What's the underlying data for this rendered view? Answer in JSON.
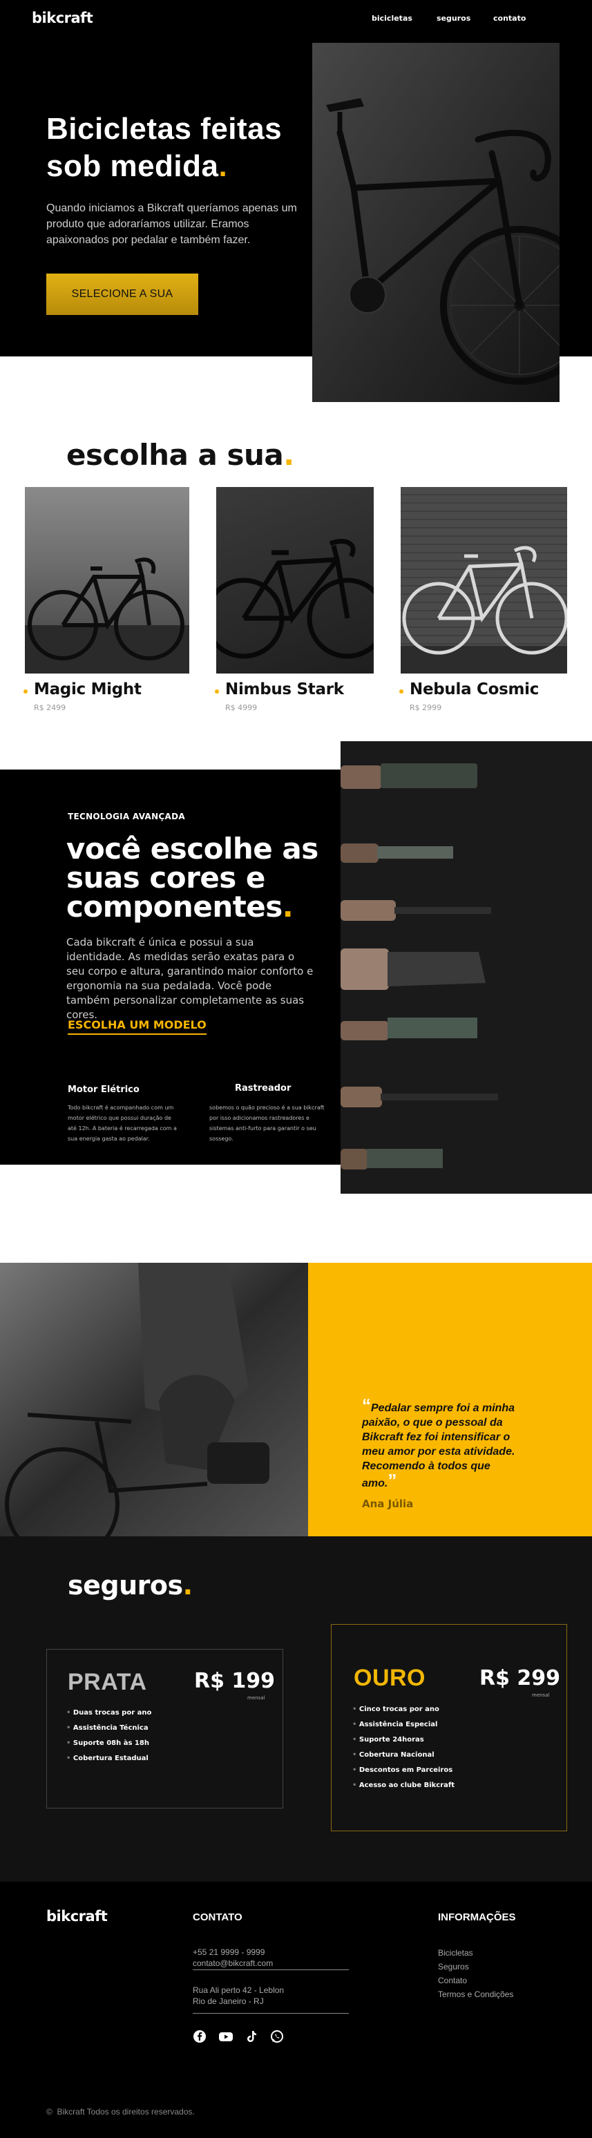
{
  "header": {
    "logo": "bikcraft",
    "nav": [
      "bicicletas",
      "seguros",
      "contato"
    ]
  },
  "hero": {
    "title_line1": "Bicicletas feitas",
    "title_line2": "sob  medida",
    "title_dot": ".",
    "subtitle": "Quando iniciamos a Bikcraft queríamos apenas um produto que adoraríamos utilizar. Eramos apaixonados por pedalar e também fazer.",
    "button": "SELECIONE A SUA"
  },
  "choose": {
    "title": "escolha a sua",
    "dot": ".",
    "bikes": [
      {
        "name": "Magic Might",
        "price": "R$ 2499"
      },
      {
        "name": "Nimbus Stark",
        "price": "R$ 4999"
      },
      {
        "name": "Nebula Cosmic",
        "price": "R$ 2999"
      }
    ]
  },
  "tech": {
    "tag": "TECNOLOGIA AVANÇADA",
    "title_l1": "você escolhe as",
    "title_l2": "suas cores e",
    "title_l3": "componentes",
    "dot": ".",
    "text": "Cada bikcraft é única e  possui a sua identidade. As medidas serão exatas para o seu  corpo e altura, garantindo maior conforto e ergonomia na sua  pedalada. Você pode também personalizar completamente as suas cores.",
    "link": "ESCOLHA UM MODELO",
    "features": [
      {
        "title": "Motor Elétrico",
        "text": "Todo bikcraft é acompanhado com um motor elétrico que possui duração de até 12h. A bateria é recarregada com a sua energia gasta ao pedalar."
      },
      {
        "title": "Rastreador",
        "text": "sobemos  o quão precioso é a sua bikcraft por isso adicionamos rastreadores e sistemas anti-furto para garantir o seu sossego."
      }
    ]
  },
  "testimonial": {
    "open_mark": "“",
    "quote": "Pedalar sempre foi a minha paixão, o  que o pessoal da Bikcraft fez  foi intensificar o meu amor por esta atividade. Recomendo à todos que amo.",
    "close_mark": "”",
    "author": "Ana Júlia"
  },
  "seguros": {
    "title": "seguros",
    "dot": ".",
    "plans": [
      {
        "name": "PRATA",
        "price": "R$ 199",
        "period": "mensal",
        "color": "#bdbdbd",
        "items": [
          "Duas trocas por ano",
          "Assistência Técnica",
          "Suporte 08h às 18h",
          "Cobertura Estadual"
        ]
      },
      {
        "name": "OURO",
        "price": "R$ 299",
        "period": "mensal",
        "color": "#f2b705",
        "items": [
          "Cinco trocas por ano",
          "Assistência Especial",
          "Suporte 24horas",
          "Cobertura Nacional",
          "Descontos em Parceiros",
          "Acesso ao clube Bikcraft"
        ]
      }
    ]
  },
  "footer": {
    "logo": "bikcraft",
    "contact_title": "CONTATO",
    "phone": "+55 21 9999 - 9999",
    "email": "contato@bikcraft.com",
    "address1": "Rua Ali  perto 42  - Leblon",
    "address2": "Rio de Janeiro - RJ",
    "info_title": "INFORMAÇÕES",
    "links": [
      "Bicicletas",
      "Seguros",
      "Contato",
      "Termos e Condições"
    ],
    "social": [
      "facebook-icon",
      "youtube-icon",
      "tiktok-icon",
      "whatsapp-icon"
    ],
    "copyright_mark": "©",
    "copyright": "Bikcraft Todos os direitos reservados."
  },
  "colors": {
    "accent": "#f7b500",
    "dark": "#000000"
  }
}
